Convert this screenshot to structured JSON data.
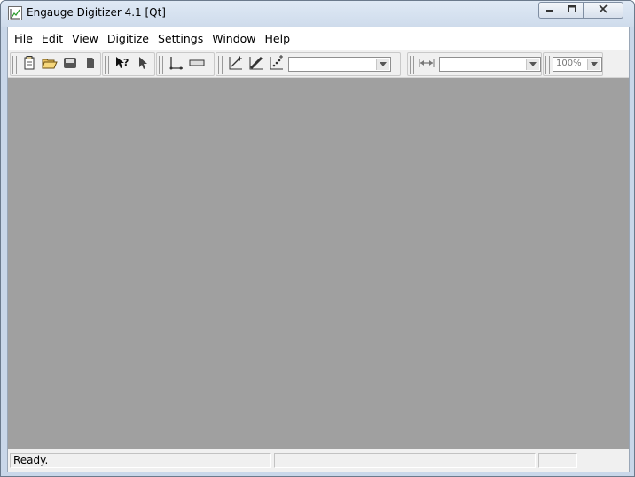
{
  "window": {
    "title": "Engauge Digitizer 4.1 [Qt]",
    "app_icon": "chart-icon"
  },
  "caption": {
    "minimize_icon": "minimize-icon",
    "maximize_icon": "maximize-icon",
    "close_icon": "close-icon"
  },
  "menu": {
    "items": [
      "File",
      "Edit",
      "View",
      "Digitize",
      "Settings",
      "Window",
      "Help"
    ]
  },
  "toolbar": {
    "file_icons": [
      "new-document-icon",
      "open-folder-icon",
      "save-icon",
      "print-icon"
    ],
    "digitize_icons": [
      "whats-this-icon",
      "select-pointer-icon"
    ],
    "axis_icons": [
      "axis-point-icon",
      "scale-bar-icon"
    ],
    "curve_icons": [
      "curve-point-icon",
      "segment-fill-icon",
      "point-match-icon"
    ],
    "curve_select_value": "",
    "measure_icon": "measure-distance-icon",
    "measure_select_value": "",
    "zoom_value": "100%"
  },
  "status": {
    "message": "Ready.",
    "cell2": "",
    "cell3": ""
  },
  "colors": {
    "workspace": "#a0a0a0",
    "chrome": "#f0f0f0",
    "title_gradient_top": "#dfe9f5"
  }
}
